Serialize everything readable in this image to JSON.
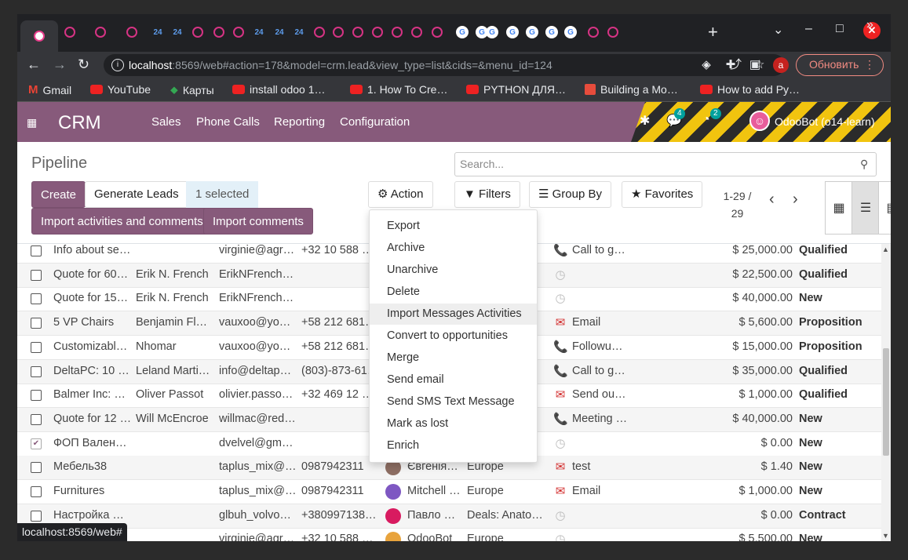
{
  "browser": {
    "tabs": [
      "o",
      "o",
      "o",
      "24",
      "24",
      "o",
      "o",
      "o",
      "24",
      "24",
      "24",
      "o",
      "o",
      "o",
      "o",
      "o",
      "o",
      "o",
      "G",
      "G",
      "G",
      "G",
      "G",
      "G",
      "G",
      "o",
      "o"
    ],
    "new_tab": "+",
    "url_host": "localhost",
    "url_rest": ":8569/web#action=178&model=crm.lead&view_type=list&cids=&menu_id=124",
    "avatar_letter": "a",
    "update_label": "Обновить",
    "status_url": "localhost:8569/web#"
  },
  "bookmarks": [
    {
      "label": "Gmail",
      "icon": "gmail-icon"
    },
    {
      "label": "YouTube",
      "icon": "youtube-icon"
    },
    {
      "label": "Карты",
      "icon": "maps-icon"
    },
    {
      "label": "install odoo 1…",
      "icon": "youtube-icon"
    },
    {
      "label": "1. How To Cre…",
      "icon": "youtube-icon"
    },
    {
      "label": "PYTHON ДЛЯ…",
      "icon": "youtube-icon"
    },
    {
      "label": "Building a Mo…",
      "icon": "stackoverflow-icon"
    },
    {
      "label": "How to add Py…",
      "icon": "youtube-icon"
    }
  ],
  "navbar": {
    "brand": "CRM",
    "menu": [
      "Sales",
      "Phone Calls",
      "Reporting",
      "Configuration"
    ],
    "messages_count": "4",
    "activities_count": "2",
    "user": "OdooBot (o14-learn)"
  },
  "control_panel": {
    "title": "Pipeline",
    "search_placeholder": "Search...",
    "create": "Create",
    "generate_leads": "Generate Leads",
    "selected": "1 selected",
    "action": "Action",
    "import_activities": "Import activities and comments",
    "import_comments": "Import comments",
    "filters": "Filters",
    "group_by": "Group By",
    "favorites": "Favorites",
    "pager_line1": "1-29 /",
    "pager_line2": "29"
  },
  "action_menu": [
    "Export",
    "Archive",
    "Unarchive",
    "Delete",
    "Import Messages Activities",
    "Convert to opportunities",
    "Merge",
    "Send email",
    "Send SMS Text Message",
    "Mark as lost",
    "Enrich"
  ],
  "rows": [
    {
      "name": "Info about se…",
      "contact": "",
      "email": "virginie@agr…",
      "phone": "+32 10 588 …",
      "person": "",
      "team": "",
      "activity_icon": "phone",
      "activity": "Call to g…",
      "revenue": "$ 25,000.00",
      "stage": "Qualified",
      "checked": false
    },
    {
      "name": "Quote for 60…",
      "contact": "Erik N. French",
      "email": "ErikNFrench…",
      "phone": "",
      "person": "",
      "team": "",
      "activity_icon": "clock",
      "activity": "",
      "revenue": "$ 22,500.00",
      "stage": "Qualified",
      "checked": false
    },
    {
      "name": "Quote for 15…",
      "contact": "Erik N. French",
      "email": "ErikNFrench…",
      "phone": "",
      "person": "",
      "team": "",
      "activity_icon": "clock",
      "activity": "",
      "revenue": "$ 40,000.00",
      "stage": "New",
      "checked": false
    },
    {
      "name": "5 VP Chairs",
      "contact": "Benjamin Fl…",
      "email": "vauxoo@yo…",
      "phone": "+58 212 681…",
      "person": "",
      "team": "",
      "activity_icon": "mail",
      "activity": "Email",
      "revenue": "$ 5,600.00",
      "stage": "Proposition",
      "checked": false
    },
    {
      "name": "Customizabl…",
      "contact": "Nhomar",
      "email": "vauxoo@yo…",
      "phone": "+58 212 681…",
      "person": "",
      "team": "",
      "activity_icon": "phone",
      "activity": "Followu…",
      "revenue": "$ 15,000.00",
      "stage": "Proposition",
      "checked": false
    },
    {
      "name": "DeltaPC: 10 …",
      "contact": "Leland Marti…",
      "email": "info@deltap…",
      "phone": "(803)-873-61…",
      "person": "",
      "team": "",
      "activity_icon": "phone",
      "activity": "Call to g…",
      "revenue": "$ 35,000.00",
      "stage": "Qualified",
      "checked": false
    },
    {
      "name": "Balmer Inc: …",
      "contact": "Oliver Passot",
      "email": "olivier.passo…",
      "phone": "+32 469 12 …",
      "person": "",
      "team": "",
      "activity_icon": "mail",
      "activity": "Send ou…",
      "revenue": "$ 1,000.00",
      "stage": "Qualified",
      "checked": false
    },
    {
      "name": "Quote for 12 …",
      "contact": "Will McEncroe",
      "email": "willmac@red…",
      "phone": "",
      "person": "",
      "team": "",
      "activity_icon": "phone",
      "activity": "Meeting …",
      "revenue": "$ 40,000.00",
      "stage": "New",
      "checked": false
    },
    {
      "name": "ФОП Вален…",
      "contact": "",
      "email": "dvelvel@gm…",
      "phone": "",
      "person": "",
      "team": "…",
      "activity_icon": "clock",
      "activity": "",
      "revenue": "$ 0.00",
      "stage": "New",
      "checked": true
    },
    {
      "name": "Мебель38",
      "contact": "",
      "email": "taplus_mix@…",
      "phone": "0987942311",
      "person": "Євгенія…",
      "team": "Europe",
      "activity_icon": "mail",
      "activity": "test",
      "revenue": "$ 1.40",
      "stage": "New",
      "checked": false
    },
    {
      "name": "Furnitures",
      "contact": "",
      "email": "taplus_mix@…",
      "phone": "0987942311",
      "person": "Mitchell …",
      "team": "Europe",
      "activity_icon": "mail",
      "activity": "Email",
      "revenue": "$ 1,000.00",
      "stage": "New",
      "checked": false
    },
    {
      "name": "Настройка …",
      "contact": "",
      "email": "glbuh_volvo…",
      "phone": "+380997138…",
      "person": "Павло …",
      "team": "Deals: Anato…",
      "activity_icon": "clock",
      "activity": "",
      "revenue": "$ 0.00",
      "stage": "Contract",
      "checked": false
    },
    {
      "name": "",
      "contact": "",
      "email": "virginie@agr…",
      "phone": "+32 10 588 …",
      "person": "OdooBot",
      "team": "Europe",
      "activity_icon": "clock",
      "activity": "",
      "revenue": "$ 5,500.00",
      "stage": "New",
      "checked": false
    }
  ],
  "colors": {
    "brand": "#875a7b",
    "stage_text": "#333333",
    "activity_red": "#d32f2f"
  }
}
